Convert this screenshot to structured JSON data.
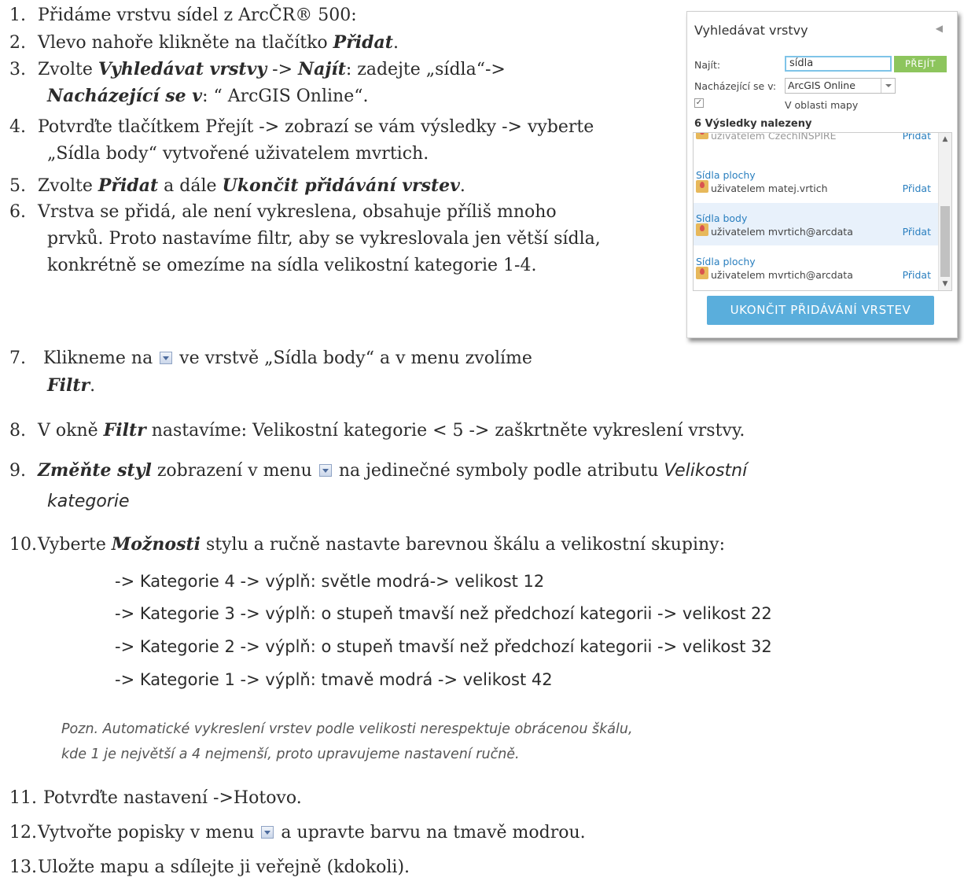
{
  "steps": {
    "s1": {
      "num": "1.",
      "a": "Přidáme vrstvu sídel z ArcČR® 500:"
    },
    "s2": {
      "num": "2.",
      "a": "Vlevo nahoře klikněte na tlačítko ",
      "b": "Přidat",
      "c": "."
    },
    "s3": {
      "num": "3.",
      "a": "Zvolte ",
      "b": "Vyhledávat vrstvy",
      "c": " -> ",
      "d": "Najít",
      "e": ": zadejte „sídla“->",
      "f": "Nacházející se v",
      "g": ": “ ArcGIS Online“."
    },
    "s4": {
      "num": "4.",
      "a": "Potvrďte tlačítkem Přejít -> zobrazí se vám výsledky -> vyberte",
      "b": "„Sídla body“ vytvořené uživatelem mvrtich."
    },
    "s5": {
      "num": "5.",
      "a": "Zvolte ",
      "b": "Přidat",
      "c": " a dále ",
      "d": "Ukončit přidávání vrstev",
      "e": "."
    },
    "s6": {
      "num": "6.",
      "a": "Vrstva se přidá, ale není vykreslena, obsahuje příliš mnoho",
      "b": "prvků. Proto nastavíme filtr, aby se vykreslovala jen větší sídla,",
      "c": "konkrétně se omezíme na sídla velikostní kategorie 1-4."
    },
    "s7": {
      "num": "7.",
      "a": " Klikneme na ",
      "b": " ve vrstvě „Sídla body“ a v menu zvolíme",
      "c": "Filtr",
      "d": "."
    },
    "s8": {
      "num": "8.",
      "a": "V okně ",
      "b": "Filtr",
      "c": " nastavíme: Velikostní kategorie < 5 -> zaškrtněte vykreslení vrstvy."
    },
    "s9": {
      "num": "9.",
      "a": "Změňte styl",
      "b": " zobrazení v menu ",
      "c": " na jedinečné symboly podle atributu ",
      "d": "Velikostní",
      "e": "kategorie"
    },
    "s10": {
      "num": "10.",
      "a": "Vyberte ",
      "b": "Možnosti",
      "c": " stylu a ručně nastavte barevnou škálu a velikostní skupiny:"
    },
    "s11": {
      "num": "11.",
      "a": " Potvrďte nastavení ->Hotovo."
    },
    "s12": {
      "num": "12.",
      "a": "Vytvořte popisky v menu ",
      "b": " a upravte barvu na tmavě modrou."
    },
    "s13": {
      "num": "13.",
      "a": "Uložte mapu a sdílejte ji veřejně (kdokoli)."
    }
  },
  "sub_items": [
    "-> Kategorie 4 -> výplň: světle modrá-> velikost 12",
    "-> Kategorie 3 -> výplň: o stupeň tmavší než předchozí kategorii -> velikost 22",
    "-> Kategorie 2 -> výplň: o stupeň tmavší než předchozí kategorii -> velikost 32",
    "-> Kategorie 1 -> výplň: tmavě modrá -> velikost 42"
  ],
  "note": {
    "line1": "Pozn. Automatické vykreslení vrstev podle velikosti nerespektuje obrácenou škálu,",
    "line2": "kde 1 je největší a 4 nejmenší, proto upravujeme nastavení ručně."
  },
  "panel": {
    "title": "Vyhledávat vrstvy",
    "collapse_glyph": "◀",
    "find_label": "Najít:",
    "find_value": "sídla",
    "go_label": "PŘEJÍT",
    "within_label": "Nacházející se v:",
    "within_value": "ArcGIS Online",
    "check_glyph": "✓",
    "map_area_label": "V oblasti mapy",
    "results_count": "6 Výsledky nalezeny",
    "results": [
      {
        "name": "",
        "owner": "uživatelem CzechINSPIRE",
        "add": "Přidat"
      },
      {
        "name": "Sídla plochy",
        "owner": "uživatelem matej.vrtich",
        "add": "Přidat"
      },
      {
        "name": "Sídla body",
        "owner": "uživatelem mvrtich@arcdata",
        "add": "Přidat"
      },
      {
        "name": "Sídla plochy",
        "owner": "uživatelem mvrtich@arcdata",
        "add": "Přidat"
      }
    ],
    "finish_label": "UKONČIT PŘIDÁVÁNÍ VRSTEV"
  },
  "colors": {
    "go_button": "#8dc55d",
    "finish_button": "#5aaedc",
    "link": "#2a7fbf",
    "selected_row": "#e8f1fb"
  },
  "icons": {
    "menu_dropdown": "menu-dropdown-icon",
    "layer_item": "layer-item-icon"
  }
}
